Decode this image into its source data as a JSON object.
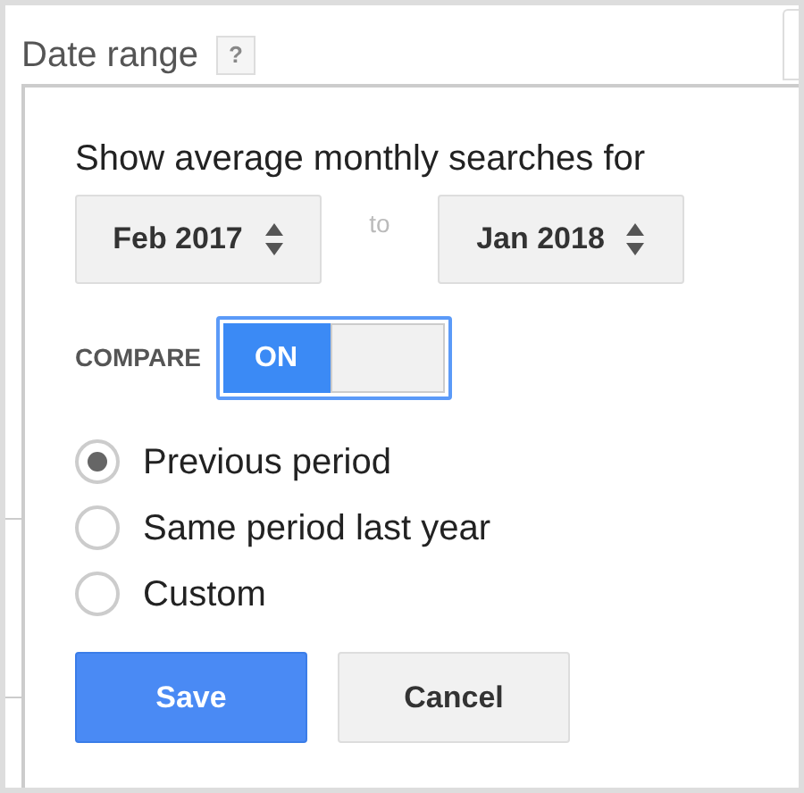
{
  "section": {
    "title": "Date range",
    "help": "?"
  },
  "popup": {
    "heading": "Show average monthly searches for",
    "range": {
      "from": "Feb 2017",
      "separator": "to",
      "to": "Jan 2018"
    },
    "compare": {
      "label": "COMPARE",
      "on_label": "ON",
      "on": true
    },
    "options": [
      {
        "label": "Previous period",
        "selected": true
      },
      {
        "label": "Same period last year",
        "selected": false
      },
      {
        "label": "Custom",
        "selected": false
      }
    ],
    "buttons": [
      {
        "label": "Save",
        "kind": "primary"
      },
      {
        "label": "Cancel",
        "kind": "secondary"
      }
    ]
  }
}
